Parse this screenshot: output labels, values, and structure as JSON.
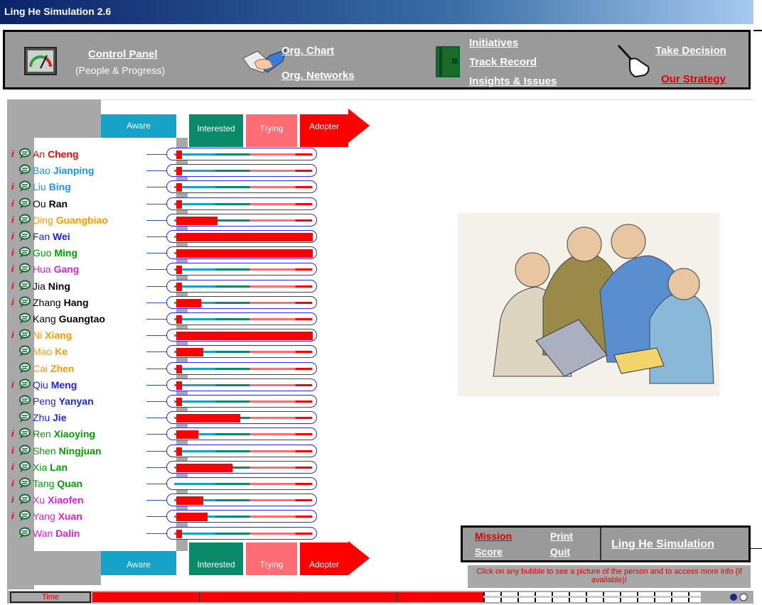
{
  "window": {
    "title": "Ling He Simulation 2.6"
  },
  "nav": {
    "control_panel": "Control Panel",
    "control_panel_sub": "(People & Progress)",
    "org_chart": "Org. Chart",
    "org_networks": "Org. Networks",
    "initiatives": "Initiatives",
    "track_record": "Track Record",
    "insights_issues": "Insights & Issues",
    "take_decision": "Take Decision",
    "our_strategy": "Our Strategy"
  },
  "stages": {
    "aware": "Aware",
    "interested": "Interested",
    "trying": "Trying",
    "adopter": "Adopter"
  },
  "stage_colors": {
    "aware": "#17a2c8",
    "interested": "#0b8a6a",
    "trying": "#ff6d74",
    "adopter": "#ff0000"
  },
  "people": [
    {
      "first": "An",
      "last": "Cheng",
      "color": "#ff0000",
      "info": true,
      "progress": 0.04
    },
    {
      "first": "Bao",
      "last": "Jianping",
      "color": "#1e90ff",
      "info": false,
      "progress": 0.04
    },
    {
      "first": "Liu",
      "last": "Bing",
      "color": "#1e90ff",
      "info": true,
      "progress": 0.04
    },
    {
      "first": "Ou",
      "last": "Ran",
      "color": "#000000",
      "info": true,
      "progress": 0.04
    },
    {
      "first": "Ding",
      "last": "Guangbiao",
      "color": "#ff9a00",
      "info": true,
      "progress": 0.3
    },
    {
      "first": "Fan",
      "last": "Wei",
      "color": "#2020ff",
      "info": true,
      "progress": 1.0
    },
    {
      "first": "Guo",
      "last": "Ming",
      "color": "#00a000",
      "info": true,
      "progress": 1.0
    },
    {
      "first": "Hua",
      "last": "Gang",
      "color": "#e020e0",
      "info": true,
      "progress": 0.04
    },
    {
      "first": "Jia",
      "last": "Ning",
      "color": "#000000",
      "info": true,
      "progress": 0.04
    },
    {
      "first": "Zhang",
      "last": "Hang",
      "color": "#000000",
      "info": true,
      "progress": 0.18
    },
    {
      "first": "Kang",
      "last": "Guangtao",
      "color": "#000000",
      "info": false,
      "progress": 0.04
    },
    {
      "first": "Ni",
      "last": "Xiang",
      "color": "#ff9a00",
      "info": true,
      "progress": 1.0
    },
    {
      "first": "Mao",
      "last": "Ke",
      "color": "#ff9a00",
      "info": false,
      "progress": 0.2
    },
    {
      "first": "Cai",
      "last": "Zhen",
      "color": "#ff9a00",
      "info": false,
      "progress": 0.04
    },
    {
      "first": "Qiu",
      "last": "Meng",
      "color": "#2020ff",
      "info": true,
      "progress": 0.04
    },
    {
      "first": "Peng",
      "last": "Yanyan",
      "color": "#2020ff",
      "info": false,
      "progress": 0.04
    },
    {
      "first": "Zhu",
      "last": "Jie",
      "color": "#2020ff",
      "info": false,
      "progress": 0.47
    },
    {
      "first": "Ren",
      "last": "Xiaoying",
      "color": "#00a000",
      "info": true,
      "progress": 0.16
    },
    {
      "first": "Shen",
      "last": "Ningjuan",
      "color": "#00a000",
      "info": true,
      "progress": 0.04
    },
    {
      "first": "Xia",
      "last": "Lan",
      "color": "#00a000",
      "info": true,
      "progress": 0.41
    },
    {
      "first": "Tang",
      "last": "Quan",
      "color": "#00a000",
      "info": true,
      "progress": 0.0
    },
    {
      "first": "Xu",
      "last": "Xiaofen",
      "color": "#e020e0",
      "info": true,
      "progress": 0.2
    },
    {
      "first": "Yang",
      "last": "Xuan",
      "color": "#e020e0",
      "info": true,
      "progress": 0.23
    },
    {
      "first": "Wan",
      "last": "Dalin",
      "color": "#e020e0",
      "info": false,
      "progress": 0.04
    }
  ],
  "bottom": {
    "mission": "Mission",
    "score": "Score",
    "print": "Print",
    "quit": "Quit",
    "ling_he": "Ling He Simulation",
    "hint": "Click on any bubble to see a picture of the person and to access more info (if available)!"
  },
  "timebar": {
    "label": "Time"
  },
  "icons": {
    "control_panel": "gauge-icon",
    "org_chart": "handshake-icon",
    "initiatives": "book-icon",
    "take_decision": "pointing-hand-icon",
    "bubble": "speech-bubble-icon",
    "info": "info-icon"
  }
}
